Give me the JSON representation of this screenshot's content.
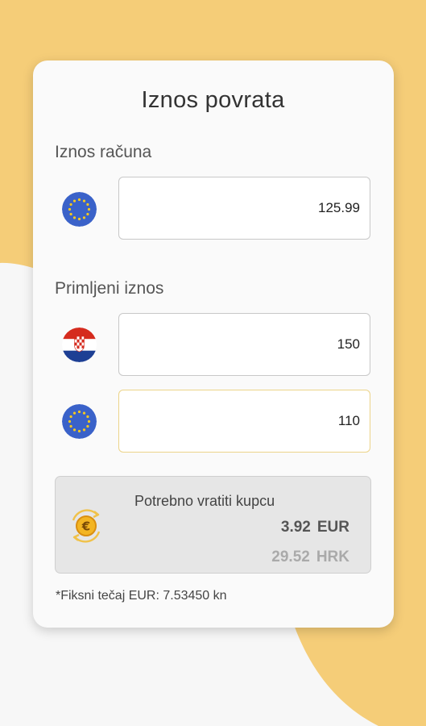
{
  "header": {
    "title": "Iznos povrata"
  },
  "bill": {
    "label": "Iznos računa",
    "currency_icon": "eu-flag-icon",
    "value": "125.99"
  },
  "received": {
    "label": "Primljeni iznos",
    "hrk": {
      "currency_icon": "croatia-flag-icon",
      "value": "150"
    },
    "eur": {
      "currency_icon": "eu-flag-icon",
      "value": "110"
    }
  },
  "change": {
    "title": "Potrebno vratiti kupcu",
    "icon": "euro-coin-exchange-icon",
    "eur_amount": "3.92",
    "eur_code": "EUR",
    "hrk_amount": "29.52",
    "hrk_code": "HRK"
  },
  "footnote": "*Fiksni tečaj EUR: 7.53450 kn",
  "colors": {
    "background_accent": "#f5cd78",
    "card": "#fafafa",
    "active_border": "#ecd489",
    "eu_blue": "#3a62c9",
    "eu_star": "#f4c820"
  }
}
